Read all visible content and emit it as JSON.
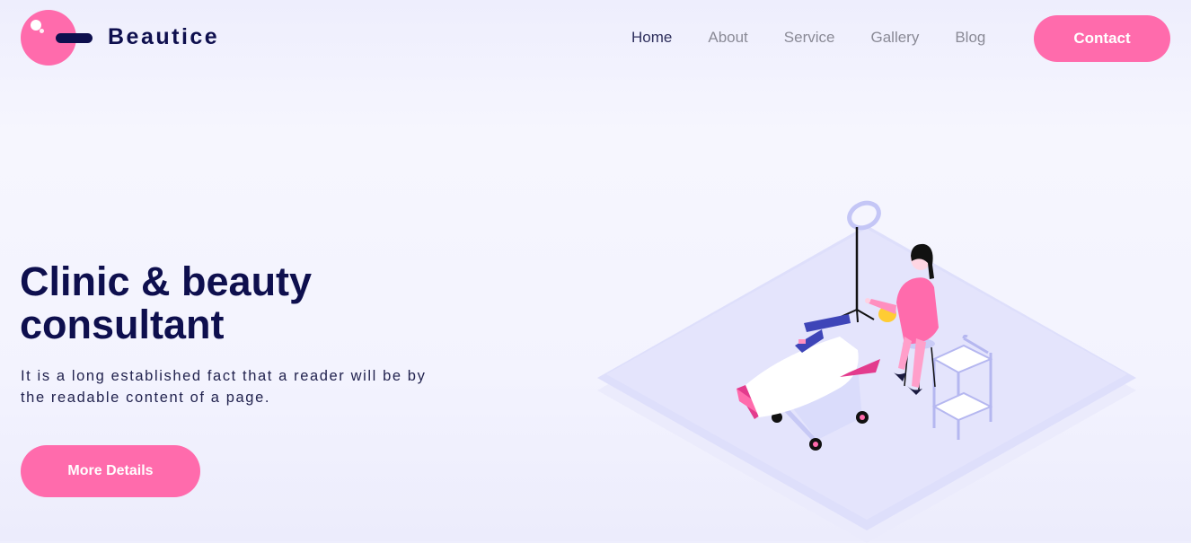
{
  "brand": {
    "name": "Beautice",
    "accent": "#ff6bac",
    "dark": "#0e0f4e"
  },
  "nav": {
    "items": [
      {
        "label": "Home",
        "active": true
      },
      {
        "label": "About",
        "active": false
      },
      {
        "label": "Service",
        "active": false
      },
      {
        "label": "Gallery",
        "active": false
      },
      {
        "label": "Blog",
        "active": false
      }
    ],
    "cta_label": "Contact"
  },
  "hero": {
    "title": "Clinic & beauty consultant",
    "description": "It is a long established fact that a reader will be by the readable content of a page.",
    "button_label": "More Details",
    "illustration": "beauty-clinic-isometric-illustration"
  }
}
